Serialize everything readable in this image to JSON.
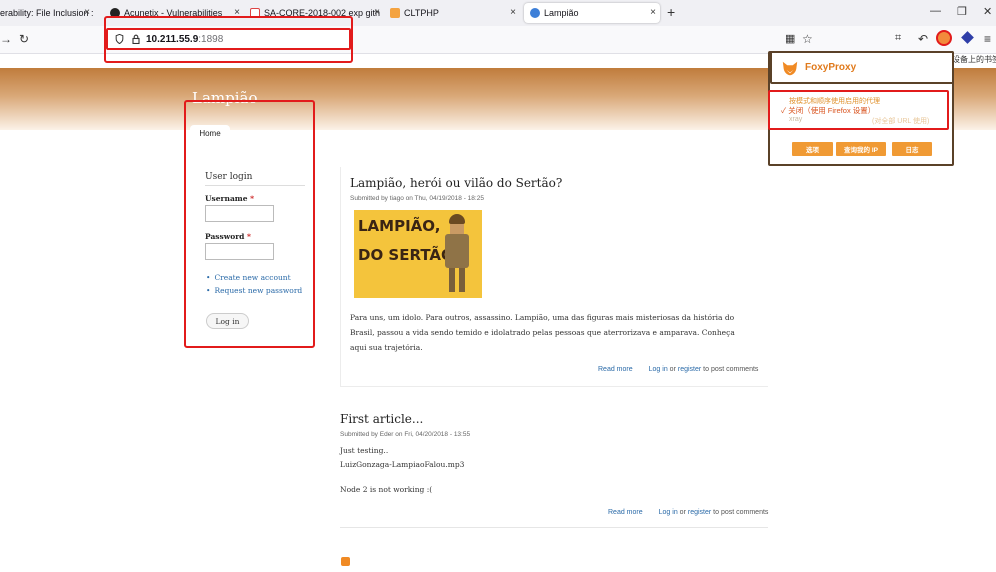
{
  "browser": {
    "tabs": [
      {
        "label": "erability: File Inclusion :",
        "close": "×"
      },
      {
        "label": "Acunetix - Vulnerabilities",
        "close": "×"
      },
      {
        "label": "SA-CORE-2018-002 exp gith",
        "close": "×"
      },
      {
        "label": "CLTPHP",
        "close": "×"
      },
      {
        "label": "Lampião",
        "close": "×"
      }
    ],
    "new_tab": "+",
    "window_controls": [
      "—",
      "❐",
      "✕"
    ],
    "url_host": "10.211.55.9",
    "url_port": ":1898",
    "bookmark_hint": "设备上的书签"
  },
  "site": {
    "name": "Lampião",
    "nav_home": "Home"
  },
  "login_block": {
    "title": "User login",
    "username_label": "Username",
    "password_label": "Password",
    "required_mark": "*",
    "links": [
      "Create new account",
      "Request new password"
    ],
    "submit": "Log in"
  },
  "articles": [
    {
      "title": "Lampião, herói ou vilão do Sertão?",
      "meta": "Submitted by tiago on Thu, 04/19/2018 - 18:25",
      "image_text": [
        "LAMPIÃO,",
        "DO SERTÃO"
      ],
      "body": "Para uns, um idolo. Para outros, assassino. Lampião, uma das figuras mais misteriosas da história do Brasil, passou a vida sendo temido e idolatrado pelas pessoas que aterrorizava e amparava. Conheça aqui sua trajetória.",
      "read_more": "Read more",
      "login": "Log in",
      "or": "or",
      "register": "register",
      "post_comments": "to post comments"
    },
    {
      "title": "First article...",
      "meta": "Submitted by Eder on Fri, 04/20/2018 - 13:55",
      "lines": [
        "Just testing..",
        "LuizGonzaga-LampiaoFalou.mp3",
        "Node 2 is not working :("
      ],
      "read_more": "Read more",
      "login": "Log in",
      "or": "or",
      "register": "register",
      "post_comments": "to post comments"
    }
  ],
  "foxyproxy": {
    "title": "FoxyProxy",
    "option_patterns": "按模式和顺序使用启用的代理",
    "option_off": "✓ 关闭（使用 Firefox 设置）",
    "option_proxy": "xray",
    "option_proxy_hint": "(对全部 URL 使用)",
    "buttons": [
      "选项",
      "查询我的 IP",
      "日志"
    ],
    "accent": "#e07a1c"
  },
  "colors": {
    "highlight_box": "#e21b1b",
    "popup_border": "#5a4128",
    "link": "#2a6aa8"
  }
}
